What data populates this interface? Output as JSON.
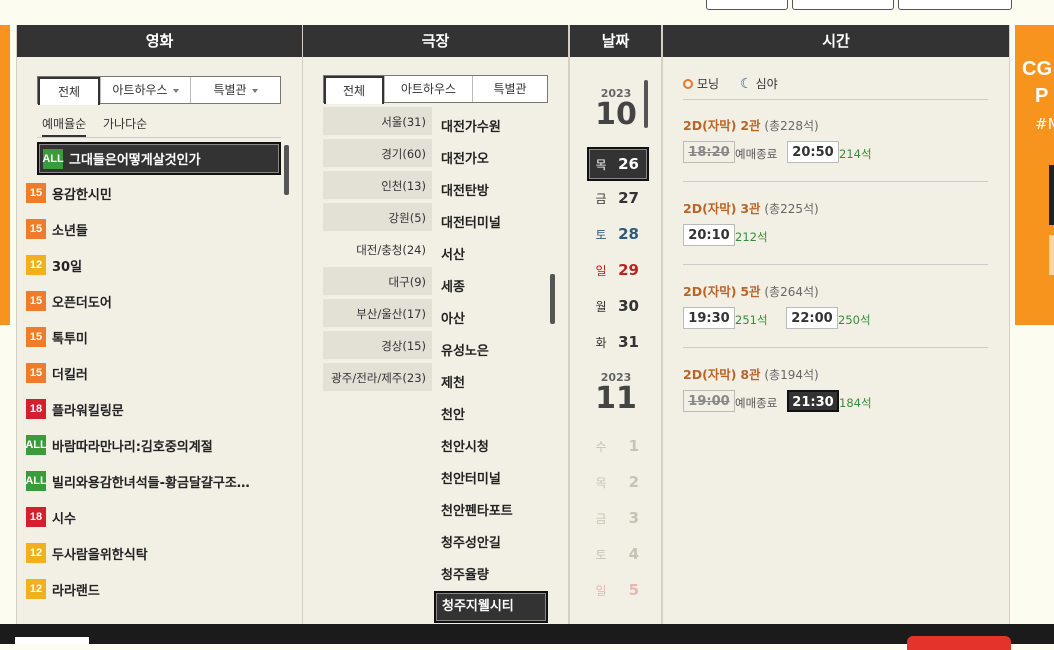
{
  "columns": {
    "movie": "영화",
    "theater": "극장",
    "date": "날짜",
    "time": "시간"
  },
  "movie_tabs": [
    "전체",
    "아트하우스",
    "특별관"
  ],
  "movie_sort": [
    "예매율순",
    "가나다순"
  ],
  "movies": [
    {
      "rating": "ALL",
      "title": "그대들은어떻게살것인가"
    },
    {
      "rating": "15",
      "title": "용감한시민"
    },
    {
      "rating": "15",
      "title": "소년들"
    },
    {
      "rating": "12",
      "title": "30일"
    },
    {
      "rating": "15",
      "title": "오픈더도어"
    },
    {
      "rating": "15",
      "title": "톡투미"
    },
    {
      "rating": "15",
      "title": "더킬러"
    },
    {
      "rating": "18",
      "title": "플라워킬링문"
    },
    {
      "rating": "ALL",
      "title": "바람따라만나리:김호중의계절"
    },
    {
      "rating": "ALL",
      "title": "빌리와용감한녀석들-황금달걀구조…"
    },
    {
      "rating": "18",
      "title": "시수"
    },
    {
      "rating": "12",
      "title": "두사람을위한식탁"
    },
    {
      "rating": "12",
      "title": "라라랜드"
    }
  ],
  "theater_tabs": [
    "전체",
    "아트하우스",
    "특별관"
  ],
  "regions": [
    "서울(31)",
    "경기(60)",
    "인천(13)",
    "강원(5)",
    "대전/충청(24)",
    "대구(9)",
    "부산/울산(17)",
    "경상(15)",
    "광주/전라/제주(23)"
  ],
  "theaters": [
    "대전가수원",
    "대전가오",
    "대전탄방",
    "대전터미널",
    "서산",
    "세종",
    "아산",
    "유성노은",
    "제천",
    "천안",
    "천안시청",
    "천안터미널",
    "천안펜타포트",
    "청주성안길",
    "청주율량",
    "청주지웰시티"
  ],
  "months": [
    {
      "year": "2023",
      "month": "10"
    },
    {
      "year": "2023",
      "month": "11"
    }
  ],
  "dates": [
    {
      "dow": "목",
      "day": "26"
    },
    {
      "dow": "금",
      "day": "27"
    },
    {
      "dow": "토",
      "day": "28"
    },
    {
      "dow": "일",
      "day": "29"
    },
    {
      "dow": "월",
      "day": "30"
    },
    {
      "dow": "화",
      "day": "31"
    },
    {
      "dow": "수",
      "day": "1"
    },
    {
      "dow": "목",
      "day": "2"
    },
    {
      "dow": "금",
      "day": "3"
    },
    {
      "dow": "토",
      "day": "4"
    },
    {
      "dow": "일",
      "day": "5"
    }
  ],
  "legend": {
    "morning": "모닝",
    "night": "심야"
  },
  "showtimes": [
    {
      "format": "2D(자막)",
      "hall": "2관",
      "total": "(총228석)",
      "slots": [
        {
          "time": "18:20",
          "note": "예매종료"
        },
        {
          "time": "20:50",
          "note": "214석"
        }
      ]
    },
    {
      "format": "2D(자막)",
      "hall": "3관",
      "total": "(총225석)",
      "slots": [
        {
          "time": "20:10",
          "note": "212석"
        }
      ]
    },
    {
      "format": "2D(자막)",
      "hall": "5관",
      "total": "(총264석)",
      "slots": [
        {
          "time": "19:30",
          "note": "251석"
        },
        {
          "time": "22:00",
          "note": "250석"
        }
      ]
    },
    {
      "format": "2D(자막)",
      "hall": "8관",
      "total": "(총194석)",
      "slots": [
        {
          "time": "19:00",
          "note": "예매종료"
        },
        {
          "time": "21:30",
          "note": "184석"
        }
      ]
    }
  ],
  "ad": {
    "line1": "CG",
    "line2": "P",
    "line3": "#M"
  },
  "colors": {
    "accent": "#f7941d",
    "header": "#333333",
    "hall": "#b8652a",
    "seats": "#3a8a3a",
    "sunday": "#bb2222",
    "saturday": "#31597a"
  }
}
